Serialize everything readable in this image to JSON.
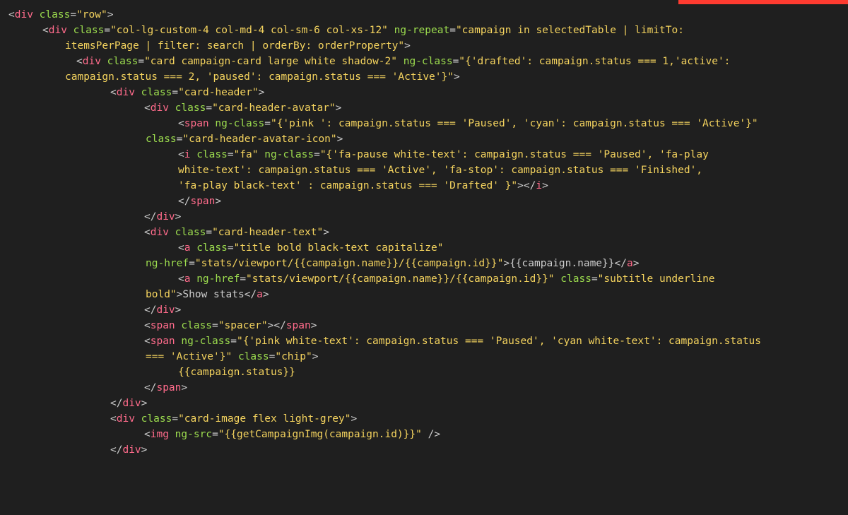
{
  "code": {
    "lines": [
      {
        "indent": "ind0",
        "seg": [
          "<",
          "div",
          " ",
          "class",
          "=",
          "\"row\"",
          ">"
        ]
      },
      {
        "indent": "ind1",
        "seg": [
          "<",
          "div",
          " ",
          "class",
          "=",
          "\"col-lg-custom-4 col-md-4 col-sm-6 col-xs-12\"",
          " ",
          "ng-repeat",
          "=",
          "\"campaign in selectedTable | limitTo:"
        ]
      },
      {
        "indent": "cont2",
        "seg": [
          "itemsPerPage | filter: search | orderBy: orderProperty\"",
          ">"
        ]
      },
      {
        "indent": "ind2",
        "seg": [
          "<",
          "div",
          " ",
          "class",
          "=",
          "\"card campaign-card large white shadow-2\"",
          " ",
          "ng-class",
          "=",
          "\"{'drafted': campaign.status === 1,'active':"
        ]
      },
      {
        "indent": "cont3",
        "seg": [
          "campaign.status === 2, 'paused': campaign.status === 'Active'}\"",
          ">"
        ]
      },
      {
        "indent": "ind3",
        "seg": [
          "<",
          "div",
          " ",
          "class",
          "=",
          "\"card-header\"",
          ">"
        ]
      },
      {
        "indent": "ind4",
        "seg": [
          "<",
          "div",
          " ",
          "class",
          "=",
          "\"card-header-avatar\"",
          ">"
        ]
      },
      {
        "indent": "ind5",
        "seg": [
          "<",
          "span",
          " ",
          "ng-class",
          "=",
          "\"{'pink ': campaign.status === 'Paused', 'cyan': campaign.status === 'Active'}\""
        ]
      },
      {
        "indent": "cont4",
        "seg": [
          "",
          "class",
          "=",
          "\"card-header-avatar-icon\"",
          ">"
        ]
      },
      {
        "indent": "cont5",
        "seg": [
          "<",
          "i",
          " ",
          "class",
          "=",
          "\"fa\"",
          " ",
          "ng-class",
          "=",
          "\"{'fa-pause white-text': campaign.status === 'Paused', 'fa-play"
        ]
      },
      {
        "indent": "cont5",
        "seg": [
          "white-text': campaign.status === 'Active', 'fa-stop': campaign.status === 'Finished',"
        ]
      },
      {
        "indent": "cont5",
        "seg": [
          "'fa-play black-text' : campaign.status === 'Drafted' }\"",
          ">",
          "</",
          "i",
          ">"
        ]
      },
      {
        "indent": "ind5",
        "seg": [
          "</",
          "span",
          ">"
        ]
      },
      {
        "indent": "ind4",
        "seg": [
          "</",
          "div",
          ">"
        ]
      },
      {
        "indent": "ind4",
        "seg": [
          "<",
          "div",
          " ",
          "class",
          "=",
          "\"card-header-text\"",
          ">"
        ]
      },
      {
        "indent": "ind5",
        "seg": [
          "<",
          "a",
          " ",
          "class",
          "=",
          "\"title bold black-text capitalize\""
        ]
      },
      {
        "indent": "cont4",
        "seg": [
          "",
          "ng-href",
          "=",
          "\"stats/viewport/{{campaign.name}}/{{campaign.id}}\"",
          ">",
          "{{campaign.name}}",
          "</",
          "a",
          ">"
        ]
      },
      {
        "indent": "ind5",
        "seg": [
          "<",
          "a",
          " ",
          "ng-href",
          "=",
          "\"stats/viewport/{{campaign.name}}/{{campaign.id}}\"",
          " ",
          "class",
          "=",
          "\"subtitle underline"
        ]
      },
      {
        "indent": "cont4",
        "seg": [
          "bold\"",
          ">",
          "Show stats",
          "</",
          "a",
          ">"
        ]
      },
      {
        "indent": "ind4",
        "seg": [
          "</",
          "div",
          ">"
        ]
      },
      {
        "indent": "ind4",
        "seg": [
          "<",
          "span",
          " ",
          "class",
          "=",
          "\"spacer\"",
          ">",
          "</",
          "span",
          ">"
        ]
      },
      {
        "indent": "ind4",
        "seg": [
          "<",
          "span",
          " ",
          "ng-class",
          "=",
          "\"{'pink white-text': campaign.status === 'Paused', 'cyan white-text': campaign.status"
        ]
      },
      {
        "indent": "cont4",
        "seg": [
          "=== 'Active'}\"",
          " ",
          "class",
          "=",
          "\"chip\"",
          ">"
        ]
      },
      {
        "indent": "ind5",
        "seg": [
          "{{campaign.status}}"
        ]
      },
      {
        "indent": "ind4",
        "seg": [
          "</",
          "span",
          ">"
        ]
      },
      {
        "indent": "ind3",
        "seg": [
          "</",
          "div",
          ">"
        ]
      },
      {
        "indent": "ind3",
        "seg": [
          "<",
          "div",
          " ",
          "class",
          "=",
          "\"card-image flex light-grey\"",
          ">"
        ]
      },
      {
        "indent": "ind4",
        "seg": [
          "<",
          "img",
          " ",
          "ng-src",
          "=",
          "\"{{getCampaignImg(campaign.id)}}\"",
          " ",
          "/>"
        ]
      },
      {
        "indent": "ind3",
        "seg": [
          "</",
          "div",
          ">"
        ]
      }
    ]
  }
}
